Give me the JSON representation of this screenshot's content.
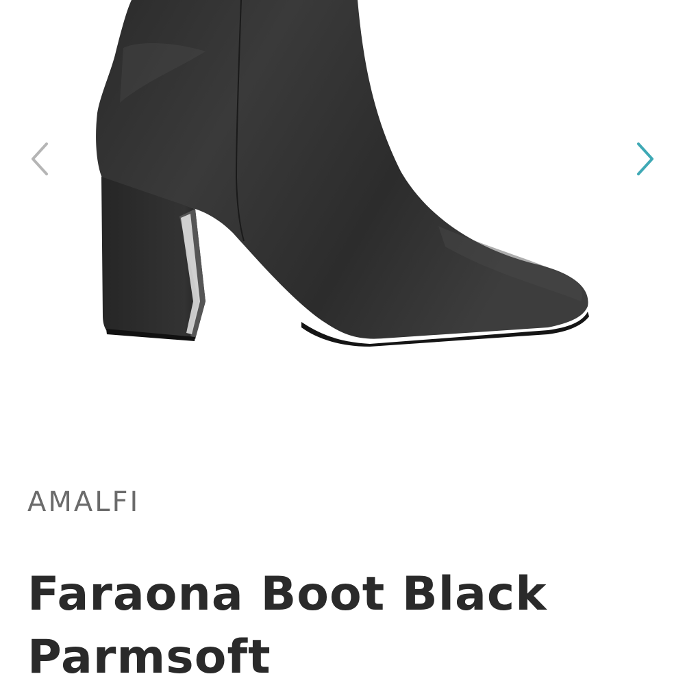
{
  "product": {
    "brand": "AMALFI",
    "title": "Faraona Boot Black Parmsoft"
  },
  "gallery": {
    "prev_icon": "chevron-left-icon",
    "next_icon": "chevron-right-icon",
    "prev_color": "#b5b5b5",
    "next_color": "#3fa9b5"
  },
  "colors": {
    "background": "#ffffff",
    "brand_text": "#6b6b6b",
    "title_text": "#2a2a2a",
    "accent": "#3fa9b5"
  }
}
